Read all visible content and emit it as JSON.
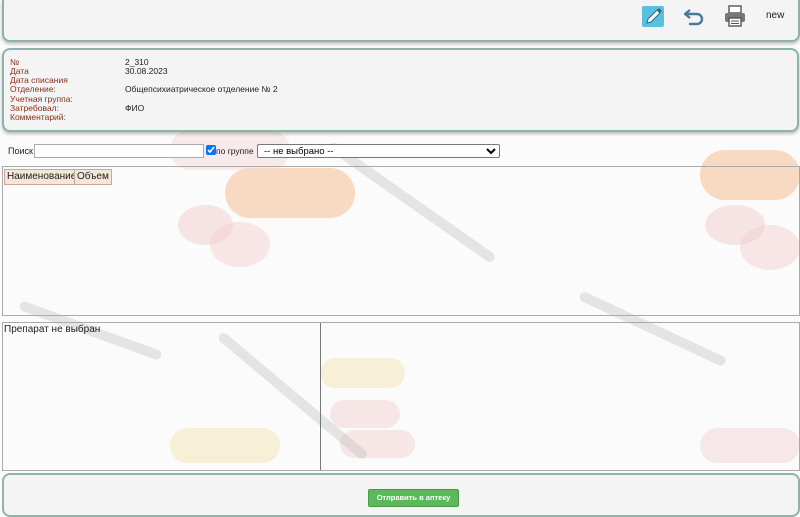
{
  "toolbar": {
    "edit_icon": "pencil-icon",
    "back_icon": "undo-arrow-icon",
    "print_icon": "printer-icon",
    "new_label": "new"
  },
  "info": {
    "number_label": "№",
    "number_value": "2_310",
    "date_label": "Дата",
    "date_value": "30.08.2023",
    "writeoff_date_label": "Дата списания",
    "writeoff_date_value": "",
    "department_label": "Отделение:",
    "department_value": "Общепсихиатрическое отделение № 2",
    "account_group_label": "Учетная группа:",
    "account_group_value": "",
    "requested_by_label": "Затребовал:",
    "requested_by_value": "ФИО",
    "comment_label": "Комментарий:",
    "comment_value": ""
  },
  "search": {
    "label": "Поиск",
    "value": "",
    "by_group_label": "по группе",
    "by_group_checked": true,
    "group_selected": "-- не выбрано --"
  },
  "table": {
    "columns": [
      "Наименование",
      "Объем"
    ]
  },
  "detail": {
    "empty_text": "Препарат не выбран"
  },
  "footer": {
    "send_label": "Отправить в аптеку"
  },
  "colors": {
    "panel_border": "#8bb5a8",
    "label_color": "#8a2f1a",
    "send_button": "#5cb85c",
    "edit_icon": "#5bc0de"
  }
}
